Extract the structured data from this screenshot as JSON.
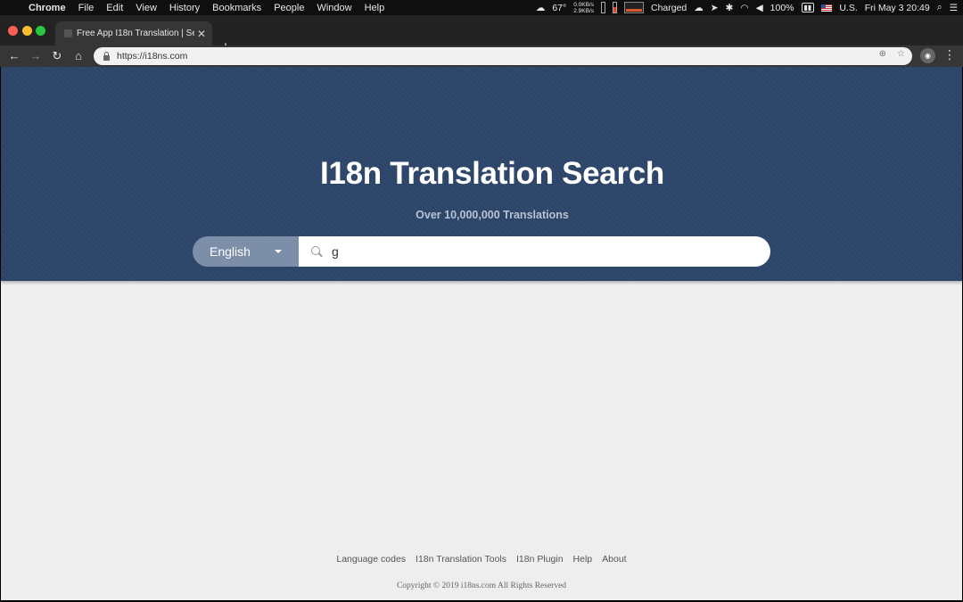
{
  "menubar": {
    "apple": "",
    "items": [
      "Chrome",
      "File",
      "Edit",
      "View",
      "History",
      "Bookmarks",
      "People",
      "Window",
      "Help"
    ],
    "temperature": "67°",
    "net_up": "0.0KB/s",
    "net_down": "2.9KB/s",
    "charge_status": "Charged",
    "battery": "100%",
    "input_source": "U.S.",
    "datetime": "Fri May 3  20:49"
  },
  "browser": {
    "tab_title": "Free App I18n Translation | Se",
    "new_tab": "+",
    "url": "https://i18ns.com"
  },
  "hero": {
    "title": "I18n Translation Search",
    "subtitle": "Over 10,000,000 Translations"
  },
  "search": {
    "language": "English",
    "query": "g"
  },
  "footer": {
    "links": [
      "Language codes",
      "I18n Translation Tools",
      "I18n Plugin",
      "Help",
      "About"
    ],
    "copyright": "Copyright © 2019 i18ns.com All Rights Reserved"
  }
}
